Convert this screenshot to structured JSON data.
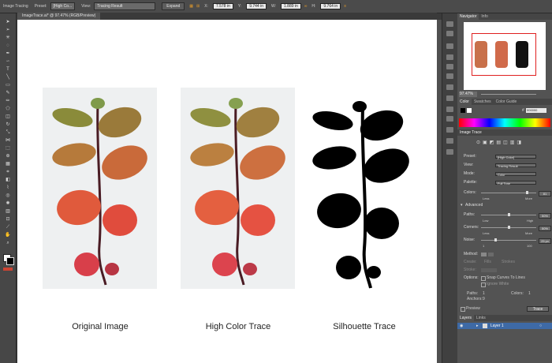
{
  "control_bar": {
    "panel_name": "Image Tracing",
    "preset_label": "Preset:",
    "preset_value": "[High Co...",
    "view_label": "View:",
    "view_value": "Tracing Result",
    "expand_label": "Expand",
    "x_value": "7.578 in",
    "y_value": "9.744 in",
    "w_value": "1.889 in",
    "h_value": "9.764 in"
  },
  "document_tab": "ImageTrace.ai* @ 97.47% (RGB/Preview)",
  "captions": {
    "original": "Original Image",
    "high_color": "High Color Trace",
    "silhouette": "Silhouette Trace"
  },
  "navigator": {
    "tab_navigator": "Navigator",
    "tab_info": "Info",
    "zoom": "97.47%"
  },
  "color_panel": {
    "tab_color": "Color",
    "tab_swatches": "Swatches",
    "tab_guide": "Color Guide",
    "hex_value": "000000",
    "hex_symbol": "#",
    "accent": "#e19a2c"
  },
  "image_trace": {
    "title": "Image Trace",
    "preset_label": "Preset:",
    "preset_value": "[High Color]",
    "view_label": "View:",
    "view_value": "Tracing Result",
    "mode_label": "Mode:",
    "mode_value": "Color",
    "palette_label": "Palette:",
    "palette_value": "Full Tone",
    "colors_label": "Colors:",
    "colors_value": "81",
    "colors_fraction": 0.85,
    "less": "Less",
    "more": "More",
    "advanced": "Advanced",
    "paths_label": "Paths:",
    "paths_value": "50%",
    "paths_fraction": 0.5,
    "low": "Low",
    "high": "High",
    "corners_label": "Corners:",
    "corners_value": "50%",
    "corners_fraction": 0.5,
    "noise_label": "Noise:",
    "noise_value": "25 px",
    "noise_fraction": 0.25,
    "noise_min": "1",
    "noise_max": "100",
    "method_label": "Method:",
    "create_label": "Create:",
    "fills": "Fills",
    "strokes": "Strokes",
    "stroke_label": "Stroke:",
    "options_label": "Options:",
    "snap_curves": "Snap Curves To Lines",
    "ignore_white": "Ignore White",
    "paths_count_label": "Paths:",
    "paths_count": "1",
    "colors_count_label": "Colors:",
    "colors_count": "1",
    "anchors_label": "Anchors:",
    "anchors_count": "9",
    "preview_label": "Preview",
    "trace_button": "Trace"
  },
  "layers": {
    "tab_layers": "Layers",
    "tab_links": "Links",
    "layer_name": "Layer 1"
  }
}
